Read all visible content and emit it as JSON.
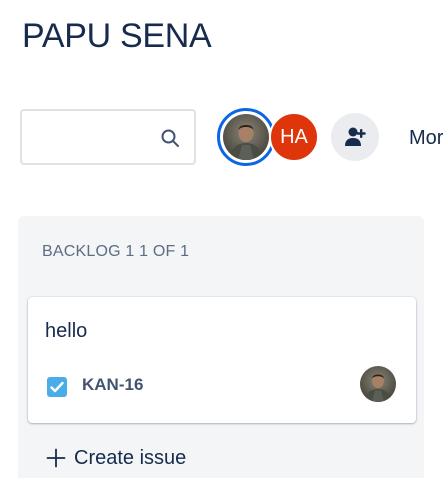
{
  "board": {
    "title": "PAPU SENA"
  },
  "toolbar": {
    "search": {
      "value": "",
      "placeholder": ""
    },
    "avatars": [
      {
        "kind": "photo",
        "selected": true
      },
      {
        "kind": "initials",
        "initials": "HA",
        "color": "#de350b"
      }
    ],
    "add_people_icon": "add-person-icon",
    "more_label": "Mor"
  },
  "column": {
    "header": "BACKLOG 1 1 OF 1",
    "cards": [
      {
        "summary": "hello",
        "issue_type_icon": "checkbox-task-icon",
        "issue_type_color": "#4bade8",
        "key": "KAN-16"
      }
    ],
    "create_label": "Create issue"
  },
  "colors": {
    "accent": "#0c66e4",
    "column_bg": "#f4f5f7",
    "text": "#172b4d",
    "muted": "#5e6c84"
  }
}
